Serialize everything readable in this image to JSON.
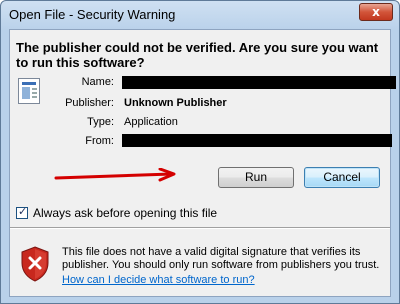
{
  "window": {
    "title": "Open File - Security Warning",
    "close_glyph": "x"
  },
  "headline": "The publisher could not be verified.  Are you sure you want to run this software?",
  "details": {
    "name_label": "Name:",
    "publisher_label": "Publisher:",
    "publisher_value": "Unknown Publisher",
    "type_label": "Type:",
    "type_value": "Application",
    "from_label": "From:"
  },
  "buttons": {
    "run": "Run",
    "cancel": "Cancel"
  },
  "checkbox": {
    "label": "Always ask before opening this file",
    "checked": true
  },
  "warning": {
    "text": "This file does not have a valid digital signature that verifies its publisher.  You should only run software from publishers you trust.",
    "help_link": "How can I decide what software to run?"
  },
  "colors": {
    "arrow": "#d40000",
    "link": "#0066cc"
  },
  "icons": [
    "application-icon",
    "security-shield-icon",
    "annotation-arrow"
  ]
}
